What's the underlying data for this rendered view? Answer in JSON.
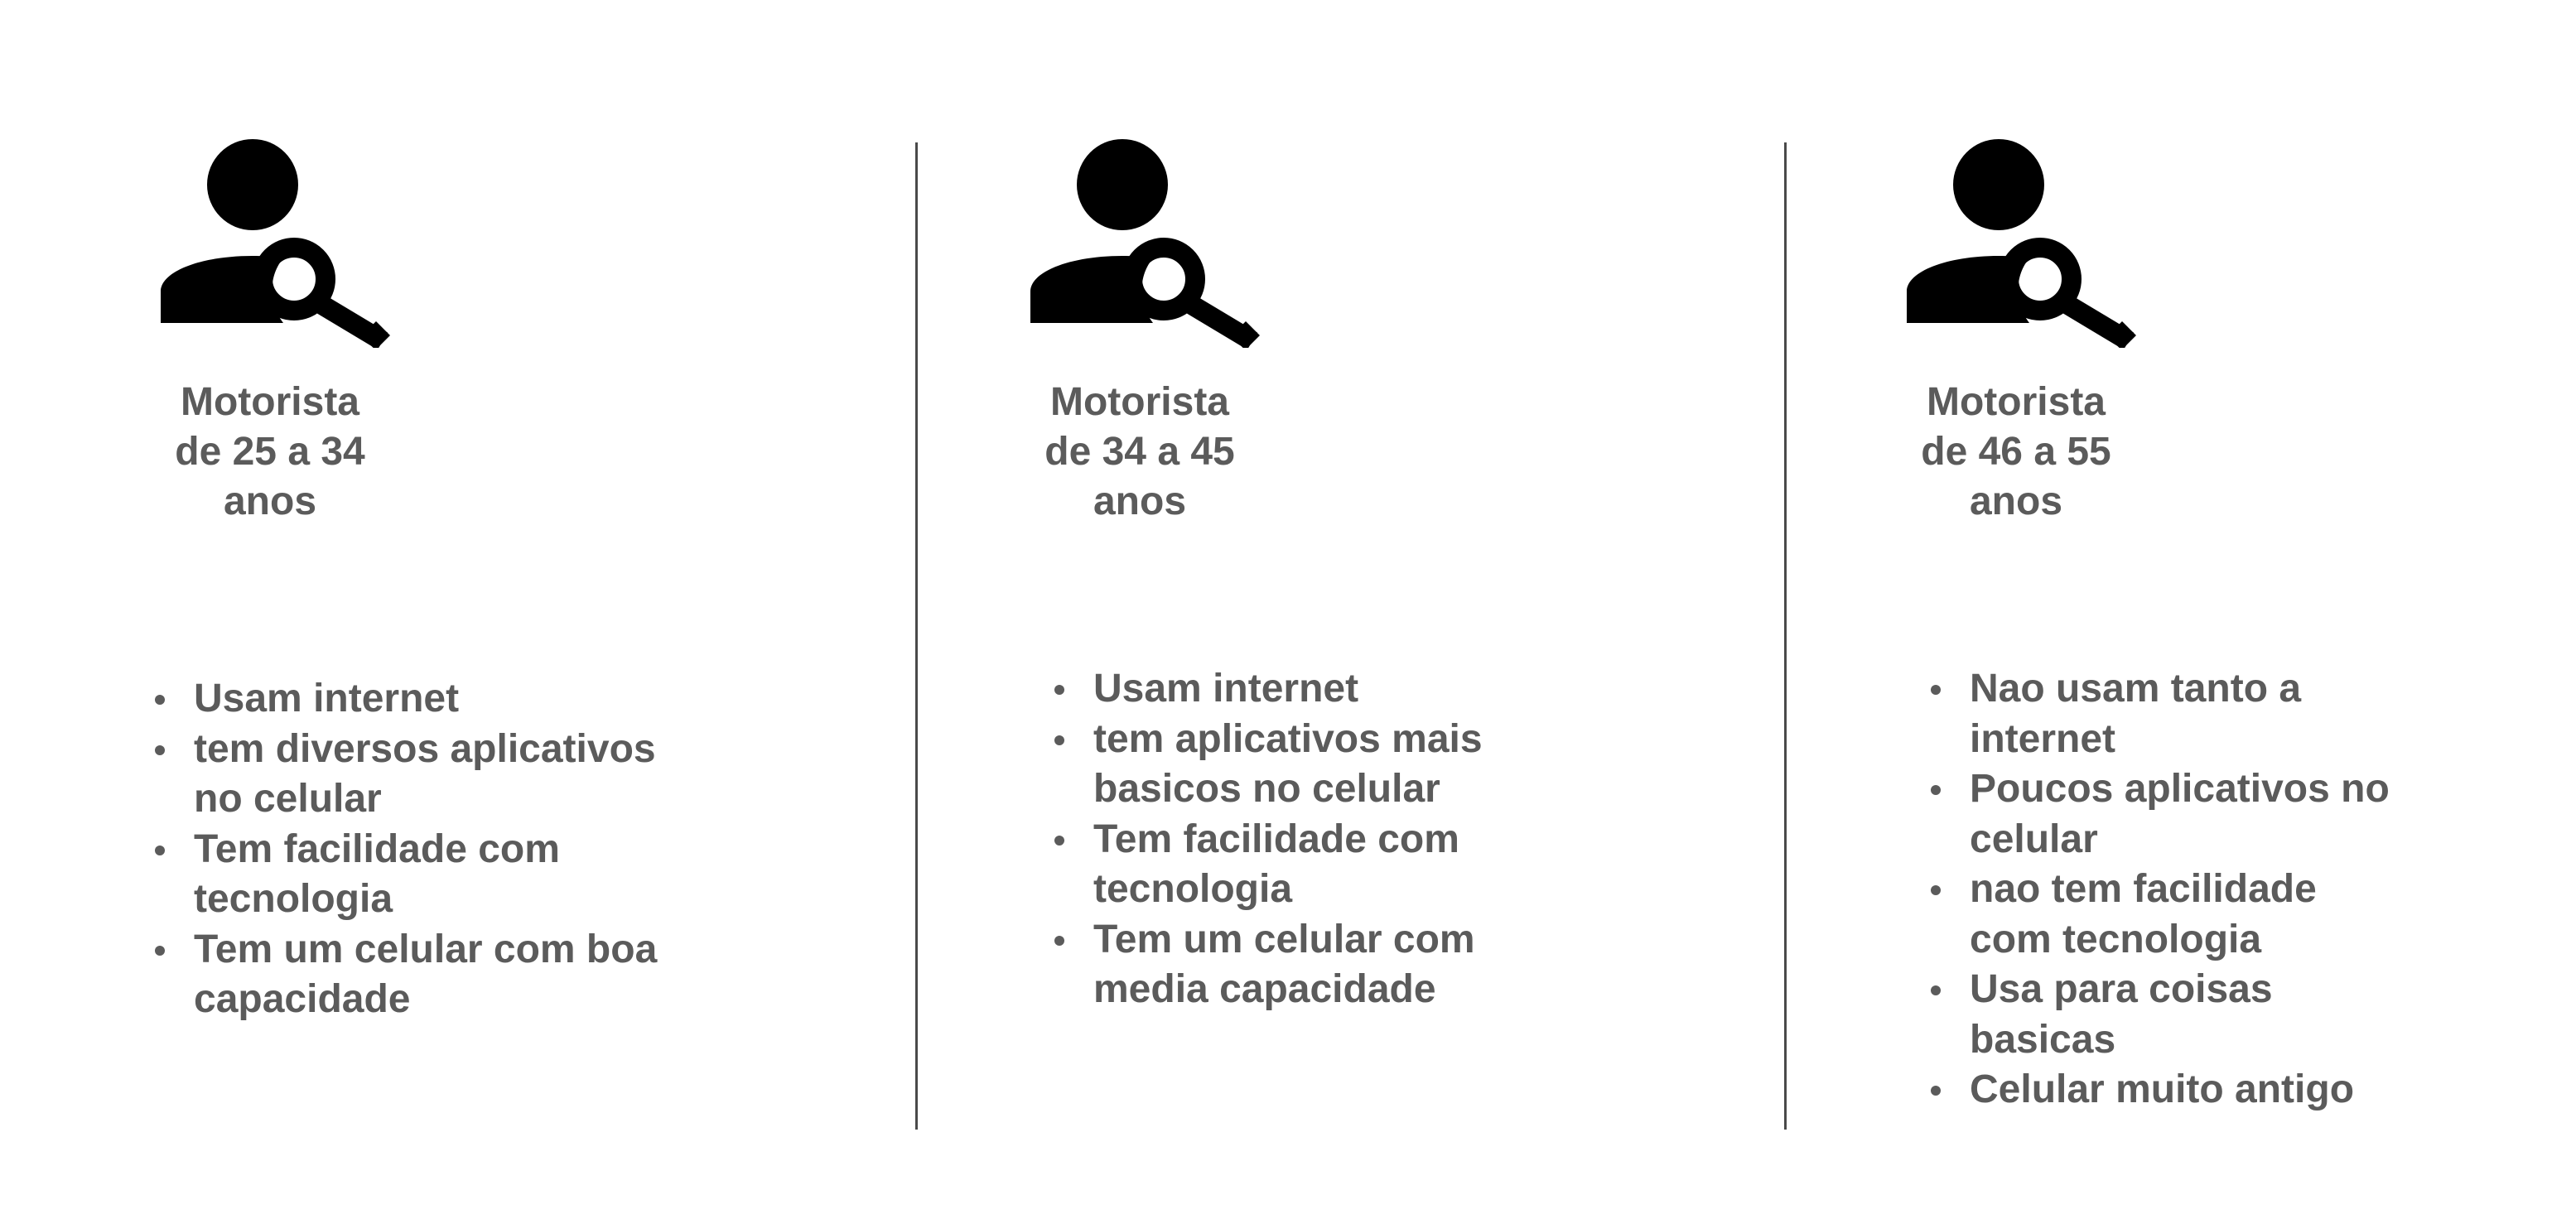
{
  "personas": [
    {
      "icon": "person-search-icon",
      "title": "Motorista\nde 25 a 34\nanos",
      "traits": [
        "Usam internet",
        "tem diversos aplicativos no celular",
        "Tem facilidade com tecnologia",
        "Tem um celular com boa capacidade"
      ]
    },
    {
      "icon": "person-search-icon",
      "title": "Motorista\nde 34 a 45\nanos",
      "traits": [
        "Usam internet",
        "tem aplicativos mais basicos no celular",
        "Tem facilidade com tecnologia",
        "Tem um celular com media capacidade"
      ]
    },
    {
      "icon": "person-search-icon",
      "title": "Motorista\nde 46 a 55\nanos",
      "traits": [
        "Nao usam tanto a internet",
        "Poucos aplicativos no celular",
        "nao tem facilidade com tecnologia",
        "Usa para coisas basicas",
        "Celular muito antigo"
      ]
    }
  ],
  "colors": {
    "icon": "#000000",
    "text": "#5b5b5b",
    "divider": "#4a4a4a",
    "background": "#ffffff"
  }
}
